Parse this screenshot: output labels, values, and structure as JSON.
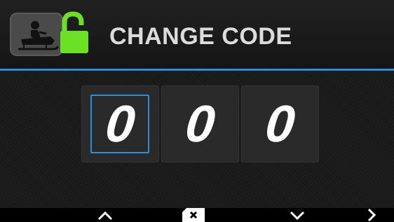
{
  "header": {
    "title": "CHANGE CODE",
    "icons": [
      "snowmobile-icon",
      "unlocked-padlock-icon"
    ],
    "lock_color": "#6ce024",
    "accent_line_color": "#2a8fd8"
  },
  "code": {
    "digits": [
      "0",
      "0",
      "0"
    ],
    "selected_index": 0,
    "selection_color": "#2a8fd8"
  },
  "nav": {
    "buttons": [
      "up-chevron-icon",
      "backspace-icon",
      "down-chevron-icon",
      "right-chevron-icon"
    ]
  }
}
